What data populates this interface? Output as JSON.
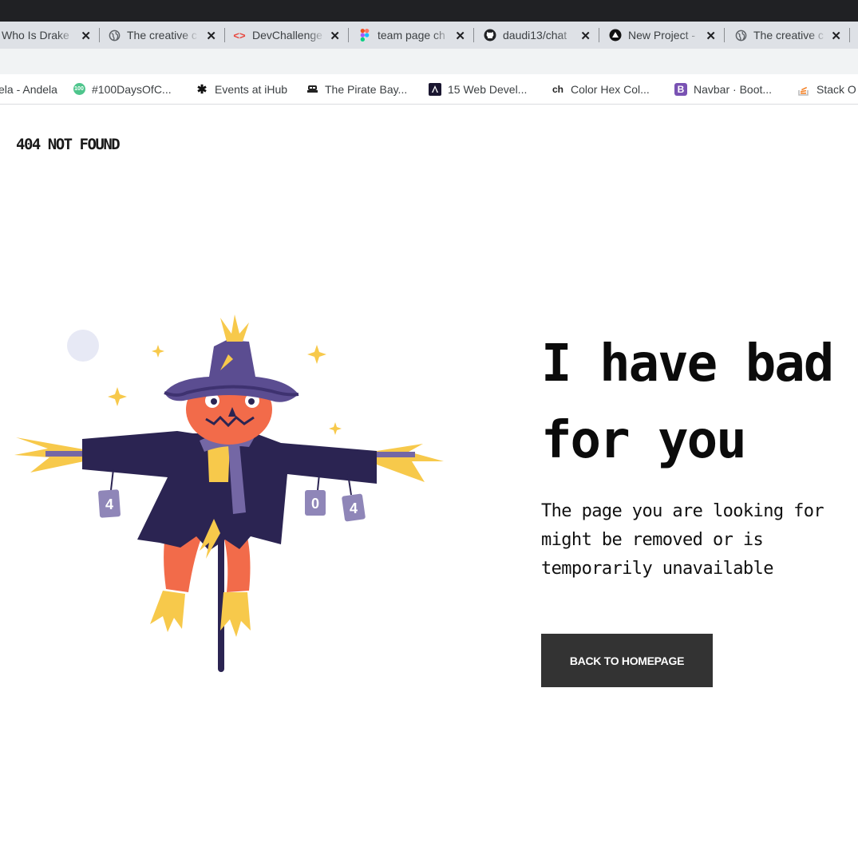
{
  "browser": {
    "tabs": [
      {
        "label": "Who Is Drake",
        "icon": "none"
      },
      {
        "label": "The creative c",
        "icon": "globe-icon"
      },
      {
        "label": "DevChallenge",
        "icon": "code-icon"
      },
      {
        "label": "team page ch",
        "icon": "figma-icon"
      },
      {
        "label": "daudi13/chat",
        "icon": "github-icon"
      },
      {
        "label": "New Project -",
        "icon": "vercel-icon"
      },
      {
        "label": "The creative c",
        "icon": "globe-icon"
      }
    ],
    "bookmarks": [
      {
        "label": "ela - Andela",
        "icon": "none"
      },
      {
        "label": "#100DaysOfC...",
        "icon": "100days-icon",
        "badge": "100"
      },
      {
        "label": "Events at iHub",
        "icon": "star-icon"
      },
      {
        "label": "The Pirate Bay...",
        "icon": "ship-icon"
      },
      {
        "label": "15 Web Devel...",
        "icon": "angular-icon"
      },
      {
        "label": "Color Hex Col...",
        "icon": "colorhex-icon",
        "badge": "ch"
      },
      {
        "label": "Navbar · Boot...",
        "icon": "bootstrap-icon",
        "badge": "B"
      },
      {
        "label": "Stack O",
        "icon": "stackoverflow-icon"
      }
    ]
  },
  "page": {
    "site_title": "404 NOT FOUND",
    "headline_line1": "I have bad",
    "headline_line2": "for you",
    "message": "The page you are looking for might be removed or is temporarily unavailable",
    "button_label": "BACK TO HOMEPAGE"
  },
  "illustration": {
    "can_labels": [
      "4",
      "0",
      "4"
    ],
    "colors": {
      "hat": "#5b4d91",
      "coat": "#2b2452",
      "face": "#f26b4a",
      "straw": "#f7c94b",
      "scarf": "#7467a5",
      "moon": "#e7e9f5"
    }
  },
  "colors": {
    "button_bg": "#333333",
    "button_text": "#ffffff",
    "text": "#0b0b0b",
    "browser_dark": "#202124",
    "tabstrip": "#dee1e6"
  }
}
